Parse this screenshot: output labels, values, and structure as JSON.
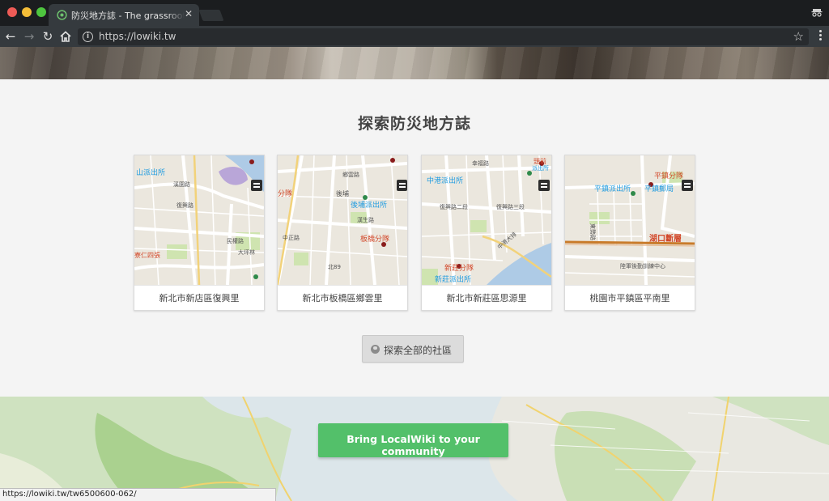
{
  "browser": {
    "tab_title": "防災地方誌 - The grassroots el",
    "url": "https://lowiki.tw"
  },
  "page": {
    "section_title": "探索防災地方誌",
    "cards": [
      {
        "label": "新北市新店區復興里",
        "map_labels": [
          "山派出所",
          "溪園路",
          "復興路",
          "民權路",
          "大坪林",
          "寮仁四張"
        ]
      },
      {
        "label": "新北市板橋區鄉雲里",
        "map_labels": [
          "分隊",
          "鄉雲路",
          "後埔",
          "後埔派出所",
          "板橋分隊",
          "北89",
          "中正路",
          "漢生路"
        ]
      },
      {
        "label": "新北市新莊區思源里",
        "map_labels": [
          "中港派出所",
          "幸福路",
          "復興路二段",
          "復興路三段",
          "中港大排",
          "新莊分隊",
          "新莊派出所",
          "頭前",
          "派出所"
        ]
      },
      {
        "label": "桃園市平鎮區平南里",
        "map_labels": [
          "平鎮分隊",
          "平鎮派出所",
          "平鎮郵局",
          "湖口斷層",
          "陸軍後勤訓練中心",
          "東勢路"
        ]
      }
    ],
    "explore_button": "探索全部的社區",
    "cta_button": "Bring LocalWiki to your community"
  },
  "status_bar": {
    "url": "https://lowiki.tw/tw6500600-062/"
  },
  "colors": {
    "cta": "#53c06a",
    "map_road": "#ffffff",
    "map_police_label": "#1e9be0",
    "map_fire_label": "#d2482a"
  }
}
